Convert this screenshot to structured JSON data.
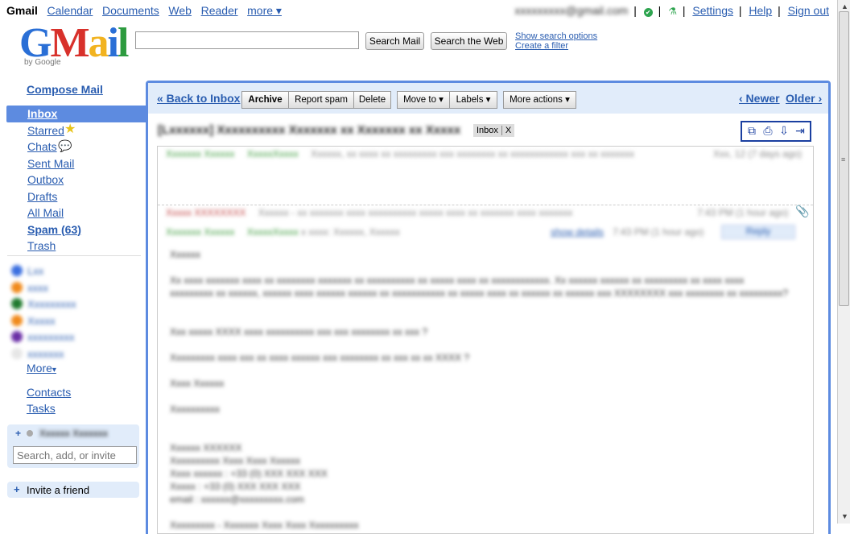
{
  "topbar": {
    "brand": "Gmail",
    "links": [
      "Calendar",
      "Documents",
      "Web",
      "Reader",
      "more ▾"
    ],
    "account": "xxxxxxxxx@gmail.com",
    "settings": "Settings",
    "help": "Help",
    "signout": "Sign out"
  },
  "logo": {
    "text_g": "G",
    "text_m": "M",
    "text_a": "a",
    "text_i": "i",
    "text_l": "l",
    "byline": "by Google"
  },
  "search": {
    "value": "",
    "search_mail": "Search Mail",
    "search_web": "Search the Web",
    "show_options": "Show search options",
    "create_filter": "Create a filter"
  },
  "sidebar": {
    "compose": "Compose Mail",
    "items": [
      {
        "label": "Inbox"
      },
      {
        "label": "Starred"
      },
      {
        "label": "Chats"
      },
      {
        "label": "Sent Mail"
      },
      {
        "label": "Outbox"
      },
      {
        "label": "Drafts"
      },
      {
        "label": "All Mail"
      },
      {
        "label": "Spam (63)"
      },
      {
        "label": "Trash"
      }
    ],
    "labels": [
      {
        "name": "Lxx",
        "color": "#3b6fe0"
      },
      {
        "name": "xxxx",
        "color": "#f08a1c"
      },
      {
        "name": "Xxxxxxxxx",
        "color": "#1f7a2e"
      },
      {
        "name": "Xxxxx",
        "color": "#f08a1c"
      },
      {
        "name": "xxxxxxxxx",
        "color": "#6a2fa6"
      },
      {
        "name": "xxxxxxx",
        "color": "#e6e6e6"
      }
    ],
    "more": "More",
    "contacts": "Contacts",
    "tasks": "Tasks",
    "chat_user": "Xxxxxx Xxxxxxx",
    "chat_placeholder": "Search, add, or invite",
    "invite": "Invite a friend"
  },
  "toolbar": {
    "back": "« Back to Inbox",
    "archive": "Archive",
    "report_spam": "Report spam",
    "delete": "Delete",
    "move_to": "Move to ▾",
    "labels": "Labels ▾",
    "more_actions": "More actions ▾",
    "newer": "‹ Newer",
    "older": "Older ›"
  },
  "thread": {
    "subject": "[Lxxxxxx] Xxxxxxxxxx Xxxxxxx xx Xxxxxxx xx Xxxxx",
    "tag": "Inbox",
    "tag_close": "X",
    "messages": [
      {
        "sender": "Xxxxxxx Xxxxxx",
        "label": "XxxxxXxxxx",
        "snippet": "Xxxxxx, xx xxxx xx xxxxxxxxx xxx xxxxxxxx xx xxxxxxxxxxxx xxx xx xxxxxxx",
        "time": "Xxx, 12 (7 days ago)"
      },
      {
        "sender": "Xxxxx XXXXXXXX",
        "label": "",
        "snippet": "Xxxxxx - xx xxxxxxx xxxx xxxxxxxxxx xxxxx xxxx xx xxxxxxx xxxx xxxxxxx",
        "time": "7:43 PM (1 hour ago)"
      },
      {
        "sender": "Xxxxxxx Xxxxxx",
        "label": "XxxxxXxxxx",
        "snippet": "x xxxx: Xxxxxx, Xxxxxx",
        "time": "7:43 PM (1 hour ago)",
        "details": "show details",
        "reply": "Reply"
      }
    ],
    "body": [
      "Xxxxxx",
      "Xx xxxx xxxxxxx xxxx xx xxxxxxxx xxxxxxx xx xxxxxxxxxx xx xxxxx xxxx xx xxxxxxxxxxxx. Xx xxxxxx xxxxxx xx xxxxxxxxx xx xxxx xxxx xxxxxxxxx xx xxxxxx, xxxxxx xxxx xxxxxx xxxxxx xx xxxxxxxxxxx xx xxxxx xxxx xx xxxxxx xx xxxxxx xxx XXXXXXXX xxx xxxxxxxx xx xxxxxxxxx?",
      "Xxx xxxxx XXXX xxxx xxxxxxxxxx xxx xxx xxxxxxxx xx xxx ?",
      "Xxxxxxxxx xxxx xxx xx xxxx xxxxxx xxx xxxxxxxx xx xxx xx xx XXXX ?",
      "Xxxx Xxxxxx",
      "Xxxxxxxxxx",
      "Xxxxxx XXXXXX",
      "Xxxxxxxxxx Xxxx Xxxx Xxxxxx",
      "Xxxx xxxxxx : +33 (0) XXX XXX XXX",
      "Xxxxx : +33 (0) XXX XXX XXX",
      "email : xxxxxx@xxxxxxxxx.com",
      "Xxxxxxxxx - Xxxxxxx Xxxx Xxxx Xxxxxxxxxx"
    ]
  }
}
